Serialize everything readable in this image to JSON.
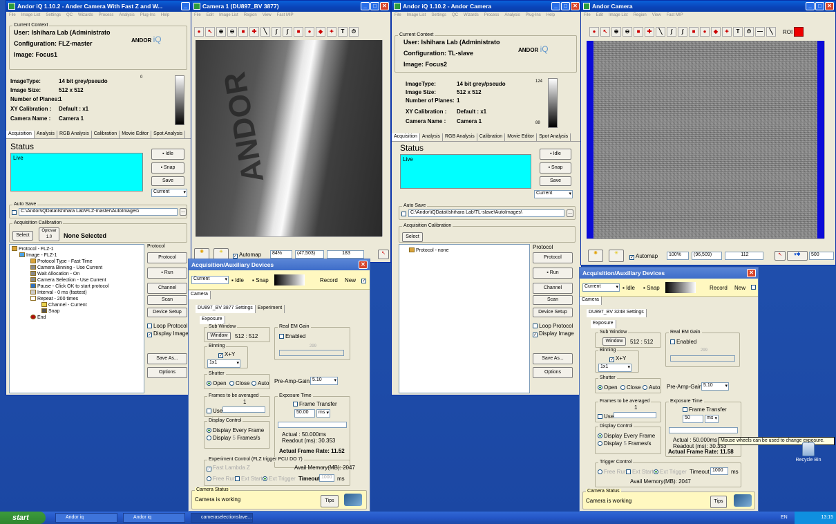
{
  "menu_items": [
    "File",
    "Image List",
    "Settings",
    "QC",
    "Wizards",
    "Process",
    "Analysis",
    "Plug-Ins",
    "Help"
  ],
  "w1": {
    "title": "Andor iQ 1.10.2 - Ander Camera With Fast Z and W...",
    "context_label": "Current Context",
    "user": "User:  Ishihara Lab (Administrato",
    "configuration": "Configuration:  FLZ-master",
    "image": "Image:  Focus1",
    "logo": "ANDOR",
    "logo_iq": "iQ",
    "props": [
      [
        "ImageType:",
        "14 bit grey/pseudo"
      ],
      [
        "Image Size:",
        "512 x 512"
      ],
      [
        "Number of Planes:",
        "1"
      ],
      [
        "XY Calibration :",
        "Default : x1"
      ],
      [
        "Camera Name :",
        "Camera 1"
      ]
    ],
    "scale_top": "0",
    "tabs": [
      "Acquisition",
      "Analysis",
      "RGB Analysis",
      "Calibration",
      "Movie Editor",
      "Spot Analysis"
    ],
    "status_label": "Status",
    "status_text": "Live",
    "btn_idle": "Idle",
    "btn_snap": "Snap",
    "btn_save": "Save",
    "select_current": "Current",
    "autosave_label": "Auto Save",
    "autosave_path": "C:\\Andor\\iQData\\Ishihara Lab\\FLZ-master\\AutoImages\\",
    "browse": "...",
    "calib_label": "Acquisition Calibration",
    "select_btn": "Select",
    "optovar_label": "Optovar",
    "optovar_value": "1.0",
    "none_selected": "None Selected",
    "tree": [
      "Protocol - FLZ-1",
      "Image - FLZ-1",
      "Protocol Type - Fast Time",
      "Camera Binning - Use Current",
      "Wait Allocation - On",
      "Camera Selection - Use Current",
      "Pause - Click OK to start protocol",
      "Interval - 0 ms (fastest)",
      "Repeat - 200 times",
      "Channel - Current",
      "Snap",
      "End"
    ],
    "protocol_label": "Protocol",
    "btn_protocol": "Protocol",
    "btn_run": "Run",
    "btn_channel": "Channel",
    "btn_scan": "Scan",
    "btn_device": "Device Setup",
    "loop_protocol": "Loop Protocol",
    "display_image": "Display Image",
    "btn_saveas": "Save As...",
    "btn_options": "Options"
  },
  "w2": {
    "title": "Camera 1 (DU897_BV 3877)",
    "menu": [
      "File",
      "Edit",
      "Image List",
      "Region",
      "View",
      "Fast MIP"
    ],
    "automap": "Automap",
    "zoom": "84%",
    "coords": "(47,503)",
    "value": "183",
    "sample_text": "ANDOR"
  },
  "w3": {
    "title": "Andor iQ 1.10.2 - Andor Camera",
    "context_label": "Current Context",
    "user": "User:  Ishihara Lab (Administrato",
    "configuration": "Configuration:  TL-slave",
    "image": "Image:  Focus2",
    "props": [
      [
        "ImageType:",
        "14 bit grey/pseudo"
      ],
      [
        "Image Size:",
        "512 x 512"
      ],
      [
        "Number of Planes:",
        "1"
      ],
      [
        "XY Calibration :",
        "Default : x1"
      ],
      [
        "Camera Name :",
        "Camera 1"
      ]
    ],
    "scale_top": "124",
    "scale_bottom": "88",
    "status_text": "Live",
    "autosave_path": "C:\\Andor\\iQData\\Ishihara Lab\\TL-slave\\AutoImages\\",
    "tree": [
      "Protocol - none"
    ]
  },
  "w4": {
    "title": "Andor Camera",
    "menu": [
      "File",
      "Edit",
      "Image List",
      "Region",
      "View",
      "Fast MIP"
    ],
    "automap": "Automap",
    "zoom": "100%",
    "coords": "(96,509)",
    "value": "112",
    "roi": "ROI",
    "right_value": "500"
  },
  "d1": {
    "title": "Acquisition/Auxiliary Devices",
    "current": "Current",
    "idle": "Idle",
    "snap": "Snap",
    "record": "Record",
    "new": "New",
    "camera_tab": "Camera",
    "settings_tab": "DU897_BV 3877 Settings",
    "experiment_tab": "Experiment",
    "exposure_tab": "Exposure",
    "sub_window": "Sub Window",
    "window_btn": "Window",
    "window_size": "512 : 512",
    "real_em_gain": "Real EM Gain",
    "enabled": "Enabled",
    "gain_value": "299",
    "binning": "Binning",
    "xy": "X+Y",
    "bin_value": "1x1",
    "shutter": "Shutter",
    "open": "Open",
    "close": "Close",
    "auto": "Auto",
    "preamp": "Pre-Amp-Gain:",
    "preamp_value": "5.10",
    "frames_avg": "Frames to be averaged",
    "frames_value": "1",
    "use": "Use",
    "exposure_time": "Exposure Time",
    "frame_transfer": "Frame Transfer",
    "exposure_value": "50.00",
    "unit": "ms",
    "display_control": "Display Control",
    "display_every": "Display Every Frame",
    "display_n": "Display",
    "display_n_value": "5",
    "frames_s": "Frames/s",
    "actual": "Actual :  50.000ms",
    "readout": "Readout (ms): 30.353",
    "actual_rate": "Actual Frame Rate: 11.52",
    "exp_control": "Experiment Control (FLZ trigger PCU DO 7)",
    "fast_lambda": "Fast Lambda Z",
    "avail_mem": "Avail Memory(MB): 2047",
    "free_run": "Free Run",
    "ext_start": "Ext Start",
    "ext_trigger": "Ext Trigger",
    "timeout": "Timeout",
    "timeout_value": "1000",
    "cam_status_label": "Camera Status",
    "cam_status": "Camera is working",
    "tips": "Tips"
  },
  "d2": {
    "title": "Acquisition/Auxiliary Devices",
    "current": "Current",
    "idle": "Idle",
    "snap": "Snap",
    "record": "Record",
    "new": "New",
    "camera_tab": "Camera",
    "settings_tab": "DU897_BV 3248 Settings",
    "exposure_tab": "Exposure",
    "sub_window": "Sub Window",
    "window_btn": "Window",
    "window_size": "512 : 512",
    "real_em_gain": "Real EM Gain",
    "enabled": "Enabled",
    "gain_value": "299",
    "binning": "Binning",
    "xy": "X+Y",
    "bin_value": "1x1",
    "shutter": "Shutter",
    "open": "Open",
    "close": "Close",
    "auto": "Auto",
    "preamp": "Pre-Amp-Gain:",
    "preamp_value": "5.10",
    "frames_avg": "Frames to be averaged",
    "frames_value": "1",
    "use": "Use",
    "exposure_time": "Exposure Time",
    "frame_transfer": "Frame Transfer",
    "exposure_value": "50",
    "unit": "ms",
    "display_control": "Display Control",
    "display_every": "Display Every Frame",
    "display_n": "Display",
    "display_n_value": "5",
    "frames_s": "Frames/s",
    "actual": "Actual :  50.000ms",
    "readout": "Readout (ms): 30.353",
    "tooltip": "Mouse wheels can be used to change exposure.",
    "actual_rate": "Actual Frame Rate: 11.58",
    "trigger_control": "Trigger Control",
    "free_run": "Free Run",
    "ext_start": "Ext Start",
    "ext_trigger": "Ext Trigger",
    "timeout": "Timeout",
    "timeout_value": "1000",
    "unit2": "ms",
    "avail_mem": "Avail Memory(MB): 2047",
    "cam_status_label": "Camera Status",
    "cam_status": "Camera is working",
    "tips": "Tips"
  },
  "desktop": {
    "recycle_bin": "Recycle Bin"
  },
  "taskbar": {
    "start": "start",
    "tasks": [
      "Andor iq",
      "Andor iq",
      "cameraselectionslave...."
    ],
    "lang": "EN",
    "time": "13:15"
  }
}
